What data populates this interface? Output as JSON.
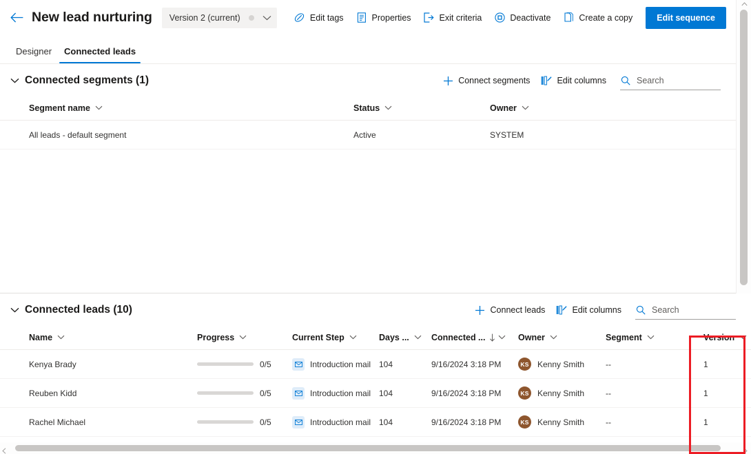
{
  "header": {
    "back_icon": "arrow-left-icon",
    "title": "New lead nurturing",
    "version_selector": {
      "label": "Version 2 (current)",
      "chevron_icon": "chevron-down-icon"
    },
    "commands": [
      {
        "label": "Edit tags",
        "icon": "tag-icon"
      },
      {
        "label": "Properties",
        "icon": "document-properties-icon"
      },
      {
        "label": "Exit criteria",
        "icon": "exit-icon"
      },
      {
        "label": "Deactivate",
        "icon": "circle-stop-icon"
      },
      {
        "label": "Create a copy",
        "icon": "copy-icon"
      }
    ],
    "primary_button": "Edit sequence"
  },
  "tabs": [
    {
      "label": "Designer",
      "active": false
    },
    {
      "label": "Connected leads",
      "active": true
    }
  ],
  "segments_section": {
    "collapse_icon": "chevron-down-icon",
    "title": "Connected segments (1)",
    "actions": [
      {
        "label": "Connect segments",
        "icon": "plus-icon"
      },
      {
        "label": "Edit columns",
        "icon": "edit-columns-icon"
      }
    ],
    "search": {
      "placeholder": "Search",
      "value": "",
      "icon": "search-icon"
    },
    "columns": [
      "Segment name",
      "Status",
      "Owner"
    ],
    "rows": [
      {
        "name": "All leads - default segment",
        "status": "Active",
        "owner": "SYSTEM"
      }
    ]
  },
  "leads_section": {
    "collapse_icon": "chevron-down-icon",
    "title": "Connected leads (10)",
    "actions": [
      {
        "label": "Connect leads",
        "icon": "plus-icon"
      },
      {
        "label": "Edit columns",
        "icon": "edit-columns-icon"
      }
    ],
    "search": {
      "placeholder": "Search",
      "value": "",
      "icon": "search-icon"
    },
    "columns": [
      {
        "label": "Name",
        "sorted": false
      },
      {
        "label": "Progress",
        "sorted": false
      },
      {
        "label": "Current Step",
        "sorted": false
      },
      {
        "label": "Days ...",
        "sorted": false
      },
      {
        "label": "Connected ...",
        "sorted": true,
        "sort_direction": "descending",
        "sort_icon": "arrow-down-icon"
      },
      {
        "label": "Owner",
        "sorted": false
      },
      {
        "label": "Segment",
        "sorted": false
      },
      {
        "label": "Version",
        "sorted": false
      }
    ],
    "rows": [
      {
        "name": "Kenya Brady",
        "progress_label": "0/5",
        "progress_percent": 0,
        "current_step": "Introduction mail",
        "days": "104",
        "connected": "9/16/2024 3:18 PM",
        "owner": "Kenny Smith",
        "owner_initials": "KS",
        "segment": "--",
        "version": "1"
      },
      {
        "name": "Reuben Kidd",
        "progress_label": "0/5",
        "progress_percent": 0,
        "current_step": "Introduction mail",
        "days": "104",
        "connected": "9/16/2024 3:18 PM",
        "owner": "Kenny Smith",
        "owner_initials": "KS",
        "segment": "--",
        "version": "1"
      },
      {
        "name": "Rachel Michael",
        "progress_label": "0/5",
        "progress_percent": 0,
        "current_step": "Introduction mail",
        "days": "104",
        "connected": "9/16/2024 3:18 PM",
        "owner": "Kenny Smith",
        "owner_initials": "KS",
        "segment": "--",
        "version": "1"
      }
    ]
  },
  "annotation": {
    "highlight_color": "#ec1c24",
    "target": "Version column"
  },
  "colors": {
    "accent": "#0078d4",
    "avatar": "#8e562e",
    "mail_chip_bg": "#deecf9",
    "progress_track": "#d9d7d5"
  }
}
